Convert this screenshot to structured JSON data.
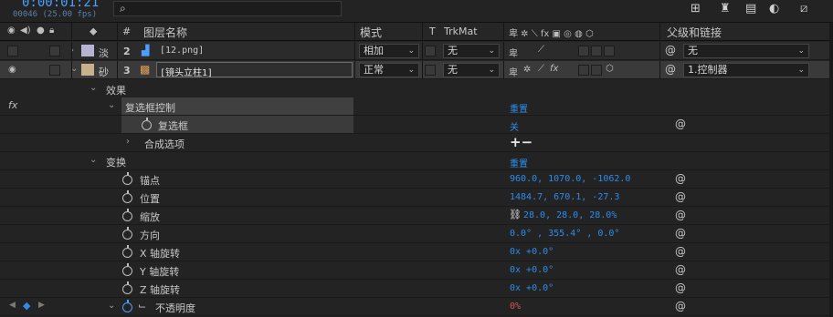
{
  "timecode": "0:00:01:21",
  "frame_info": "00046 (25.00 fps)",
  "search": {
    "placeholder": ""
  },
  "columns": {
    "hash": "#",
    "layer_name": "图层名称",
    "mode": "模式",
    "t": "T",
    "trkmat": "TrkMat",
    "parent": "父级和链接"
  },
  "layers": [
    {
      "label_text": "淡",
      "label_color": "#b4b4d2",
      "number": "2",
      "name": "[12.png]",
      "mode": "相加",
      "trkmat": "无",
      "parent": "无",
      "visible": false
    },
    {
      "label_text": "砂",
      "label_color": "#c8b08c",
      "number": "3",
      "name": "[镜头立柱1]",
      "mode": "正常",
      "trkmat": "无",
      "parent": "1.控制器",
      "visible": true
    }
  ],
  "effects": {
    "group_label": "效果",
    "fx_badge": "fx",
    "checkbox_control": "复选框控制",
    "reset": "重置",
    "checkbox": "复选框",
    "checkbox_value": "关",
    "compositing": "合成选项",
    "compositing_value": "+−"
  },
  "transform": {
    "group_label": "变换",
    "reset": "重置",
    "properties": [
      {
        "label": "锚点",
        "value": "960.0, 1070.0, -1062.0"
      },
      {
        "label": "位置",
        "value": "1484.7, 670.1, -27.3"
      },
      {
        "label": "缩放",
        "value": "28.0, 28.0, 28.0%"
      },
      {
        "label": "方向",
        "value": "0.0° , 355.4° , 0.0°"
      },
      {
        "label": "X 轴旋转",
        "value": "0x +0.0°"
      },
      {
        "label": "Y 轴旋转",
        "value": "0x +0.0°"
      },
      {
        "label": "Z 轴旋转",
        "value": "0x +0.0°"
      },
      {
        "label": "不透明度",
        "value": "0%"
      }
    ]
  },
  "colors": {
    "accent": "#2d8ceb",
    "background": "#232323",
    "opacity_value": "#d9534f"
  }
}
